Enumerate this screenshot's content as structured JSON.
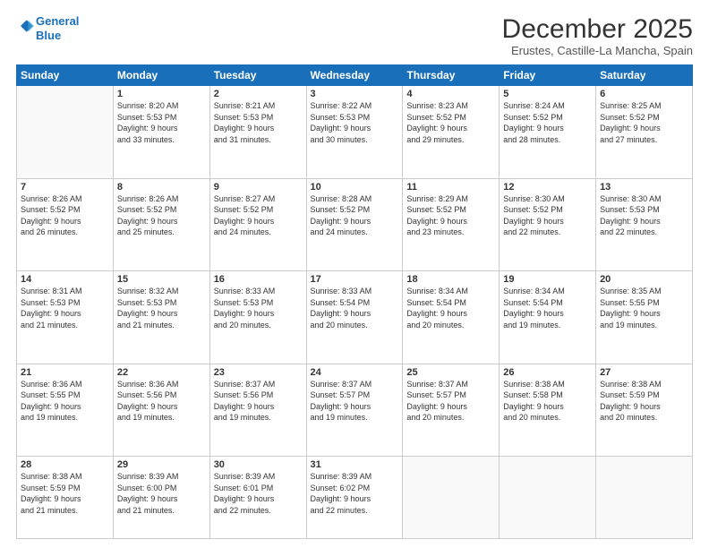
{
  "header": {
    "logo_line1": "General",
    "logo_line2": "Blue",
    "main_title": "December 2025",
    "subtitle": "Erustes, Castille-La Mancha, Spain"
  },
  "calendar": {
    "days_of_week": [
      "Sunday",
      "Monday",
      "Tuesday",
      "Wednesday",
      "Thursday",
      "Friday",
      "Saturday"
    ],
    "weeks": [
      [
        {
          "num": "",
          "info": ""
        },
        {
          "num": "1",
          "info": "Sunrise: 8:20 AM\nSunset: 5:53 PM\nDaylight: 9 hours\nand 33 minutes."
        },
        {
          "num": "2",
          "info": "Sunrise: 8:21 AM\nSunset: 5:53 PM\nDaylight: 9 hours\nand 31 minutes."
        },
        {
          "num": "3",
          "info": "Sunrise: 8:22 AM\nSunset: 5:53 PM\nDaylight: 9 hours\nand 30 minutes."
        },
        {
          "num": "4",
          "info": "Sunrise: 8:23 AM\nSunset: 5:52 PM\nDaylight: 9 hours\nand 29 minutes."
        },
        {
          "num": "5",
          "info": "Sunrise: 8:24 AM\nSunset: 5:52 PM\nDaylight: 9 hours\nand 28 minutes."
        },
        {
          "num": "6",
          "info": "Sunrise: 8:25 AM\nSunset: 5:52 PM\nDaylight: 9 hours\nand 27 minutes."
        }
      ],
      [
        {
          "num": "7",
          "info": "Sunrise: 8:26 AM\nSunset: 5:52 PM\nDaylight: 9 hours\nand 26 minutes."
        },
        {
          "num": "8",
          "info": "Sunrise: 8:26 AM\nSunset: 5:52 PM\nDaylight: 9 hours\nand 25 minutes."
        },
        {
          "num": "9",
          "info": "Sunrise: 8:27 AM\nSunset: 5:52 PM\nDaylight: 9 hours\nand 24 minutes."
        },
        {
          "num": "10",
          "info": "Sunrise: 8:28 AM\nSunset: 5:52 PM\nDaylight: 9 hours\nand 24 minutes."
        },
        {
          "num": "11",
          "info": "Sunrise: 8:29 AM\nSunset: 5:52 PM\nDaylight: 9 hours\nand 23 minutes."
        },
        {
          "num": "12",
          "info": "Sunrise: 8:30 AM\nSunset: 5:52 PM\nDaylight: 9 hours\nand 22 minutes."
        },
        {
          "num": "13",
          "info": "Sunrise: 8:30 AM\nSunset: 5:53 PM\nDaylight: 9 hours\nand 22 minutes."
        }
      ],
      [
        {
          "num": "14",
          "info": "Sunrise: 8:31 AM\nSunset: 5:53 PM\nDaylight: 9 hours\nand 21 minutes."
        },
        {
          "num": "15",
          "info": "Sunrise: 8:32 AM\nSunset: 5:53 PM\nDaylight: 9 hours\nand 21 minutes."
        },
        {
          "num": "16",
          "info": "Sunrise: 8:33 AM\nSunset: 5:53 PM\nDaylight: 9 hours\nand 20 minutes."
        },
        {
          "num": "17",
          "info": "Sunrise: 8:33 AM\nSunset: 5:54 PM\nDaylight: 9 hours\nand 20 minutes."
        },
        {
          "num": "18",
          "info": "Sunrise: 8:34 AM\nSunset: 5:54 PM\nDaylight: 9 hours\nand 20 minutes."
        },
        {
          "num": "19",
          "info": "Sunrise: 8:34 AM\nSunset: 5:54 PM\nDaylight: 9 hours\nand 19 minutes."
        },
        {
          "num": "20",
          "info": "Sunrise: 8:35 AM\nSunset: 5:55 PM\nDaylight: 9 hours\nand 19 minutes."
        }
      ],
      [
        {
          "num": "21",
          "info": "Sunrise: 8:36 AM\nSunset: 5:55 PM\nDaylight: 9 hours\nand 19 minutes."
        },
        {
          "num": "22",
          "info": "Sunrise: 8:36 AM\nSunset: 5:56 PM\nDaylight: 9 hours\nand 19 minutes."
        },
        {
          "num": "23",
          "info": "Sunrise: 8:37 AM\nSunset: 5:56 PM\nDaylight: 9 hours\nand 19 minutes."
        },
        {
          "num": "24",
          "info": "Sunrise: 8:37 AM\nSunset: 5:57 PM\nDaylight: 9 hours\nand 19 minutes."
        },
        {
          "num": "25",
          "info": "Sunrise: 8:37 AM\nSunset: 5:57 PM\nDaylight: 9 hours\nand 20 minutes."
        },
        {
          "num": "26",
          "info": "Sunrise: 8:38 AM\nSunset: 5:58 PM\nDaylight: 9 hours\nand 20 minutes."
        },
        {
          "num": "27",
          "info": "Sunrise: 8:38 AM\nSunset: 5:59 PM\nDaylight: 9 hours\nand 20 minutes."
        }
      ],
      [
        {
          "num": "28",
          "info": "Sunrise: 8:38 AM\nSunset: 5:59 PM\nDaylight: 9 hours\nand 21 minutes."
        },
        {
          "num": "29",
          "info": "Sunrise: 8:39 AM\nSunset: 6:00 PM\nDaylight: 9 hours\nand 21 minutes."
        },
        {
          "num": "30",
          "info": "Sunrise: 8:39 AM\nSunset: 6:01 PM\nDaylight: 9 hours\nand 22 minutes."
        },
        {
          "num": "31",
          "info": "Sunrise: 8:39 AM\nSunset: 6:02 PM\nDaylight: 9 hours\nand 22 minutes."
        },
        {
          "num": "",
          "info": ""
        },
        {
          "num": "",
          "info": ""
        },
        {
          "num": "",
          "info": ""
        }
      ]
    ]
  }
}
